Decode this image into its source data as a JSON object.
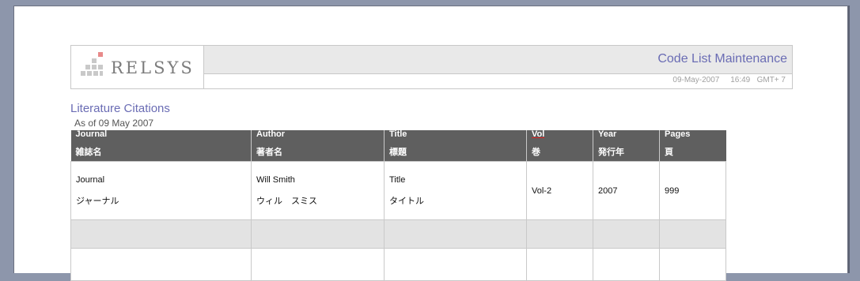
{
  "header": {
    "logo_text": "RELSYS",
    "app_title": "Code List Maintenance",
    "date": "09-May-2007",
    "time": "16:49",
    "timezone": "GMT+ 7"
  },
  "report": {
    "title": "Literature Citations",
    "subtitle": "As of 09 May 2007"
  },
  "table": {
    "columns": [
      {
        "en": "Journal",
        "jp": "雑誌名"
      },
      {
        "en": "Author",
        "jp": "著者名"
      },
      {
        "en": "Title",
        "jp": "標題"
      },
      {
        "en": "Vol",
        "jp": "巻"
      },
      {
        "en": "Year",
        "jp": "発行年"
      },
      {
        "en": "Pages",
        "jp": "頁"
      }
    ],
    "rows": [
      {
        "journal_en": "Journal",
        "journal_jp": "ジャーナル",
        "author_en": "Will Smith",
        "author_jp": "ウィル　スミス",
        "title_en": "Title",
        "title_jp": "タイトル",
        "vol": "Vol-2",
        "year": "2007",
        "pages": "999"
      }
    ]
  },
  "colors": {
    "header_bg": "#5f5f5f",
    "accent": "#6a6cb4",
    "logo_red": "#e88a8a"
  }
}
